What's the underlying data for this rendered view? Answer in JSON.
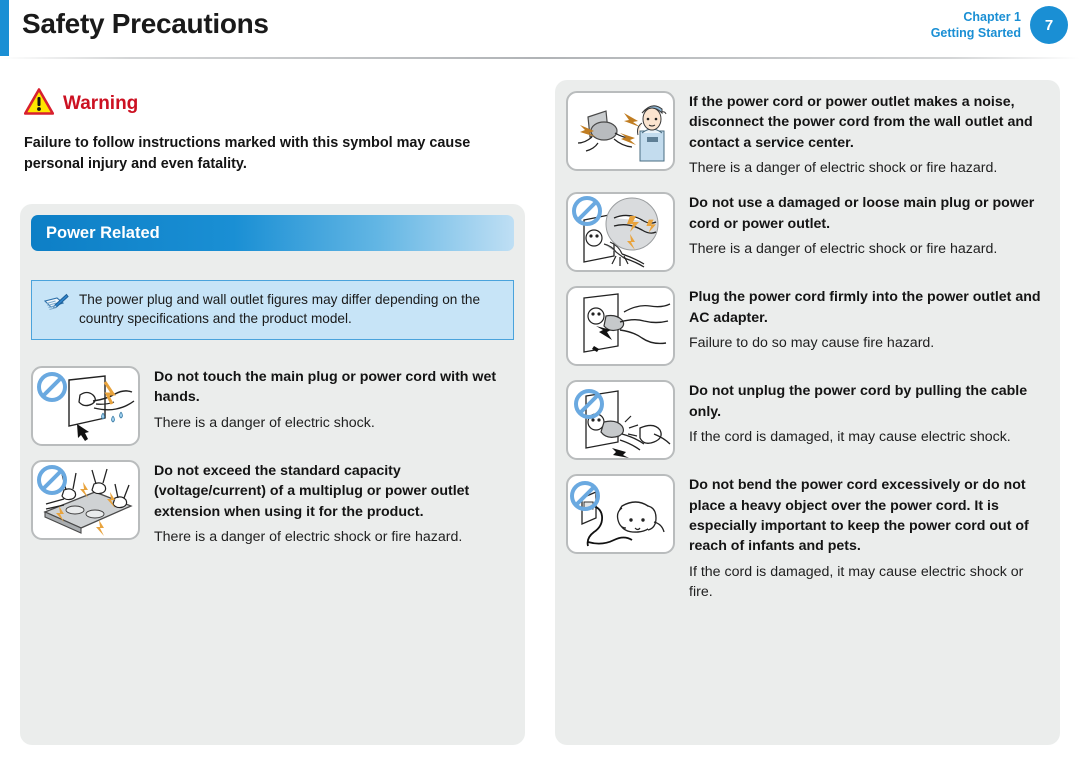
{
  "header": {
    "title": "Safety Precautions",
    "chapter": "Chapter 1",
    "section": "Getting Started",
    "page_number": "7",
    "accent_color": "#1a8fd4"
  },
  "warning": {
    "icon": "warning-triangle-icon",
    "label": "Warning",
    "label_color": "#cc1122",
    "description": "Failure to follow instructions marked with this symbol may cause personal injury and even fatality."
  },
  "section": {
    "title": "Power Related",
    "bar_color_start": "#0d7fc6",
    "bar_color_end": "#bfdff4"
  },
  "note": {
    "icon": "note-pen-icon",
    "text": "The power plug and wall outlet figures may differ depending on the country specifications and the product model.",
    "background": "#c7e4f7",
    "border_color": "#4aa3dc"
  },
  "left_items": [
    {
      "icon": "wet-hands-plug-icon",
      "title": "Do not touch the main plug or power cord with wet hands.",
      "desc": "There is a danger of electric shock."
    },
    {
      "icon": "multiplug-overload-icon",
      "title": "Do not exceed the standard capacity (voltage/current) of a multiplug or power outlet extension when using it for the product.",
      "desc": "There is a danger of electric shock or fire hazard."
    }
  ],
  "right_items": [
    {
      "icon": "service-center-call-icon",
      "title": "If the power cord or power outlet makes a noise, disconnect the power cord from the wall outlet and contact a service center.",
      "desc": "There is a danger of electric shock or fire hazard."
    },
    {
      "icon": "damaged-plug-icon",
      "title": "Do not use a damaged or loose main plug or power cord or power outlet.",
      "desc": "There is a danger of electric shock or fire hazard."
    },
    {
      "icon": "plug-firmly-icon",
      "title": "Plug the power cord firmly into the power outlet and AC adapter.",
      "desc": "Failure to do so may cause fire hazard."
    },
    {
      "icon": "pull-cable-icon",
      "title": "Do not unplug the power cord by pulling the cable only.",
      "desc": "If the cord is damaged, it may cause electric shock."
    },
    {
      "icon": "bend-cord-pet-icon",
      "title": "Do not bend the power cord excessively or do not place a heavy object over the power cord. It is especially important to keep the power cord out of reach of infants and pets.",
      "desc": "If the cord is damaged, it may cause electric shock or fire."
    }
  ]
}
